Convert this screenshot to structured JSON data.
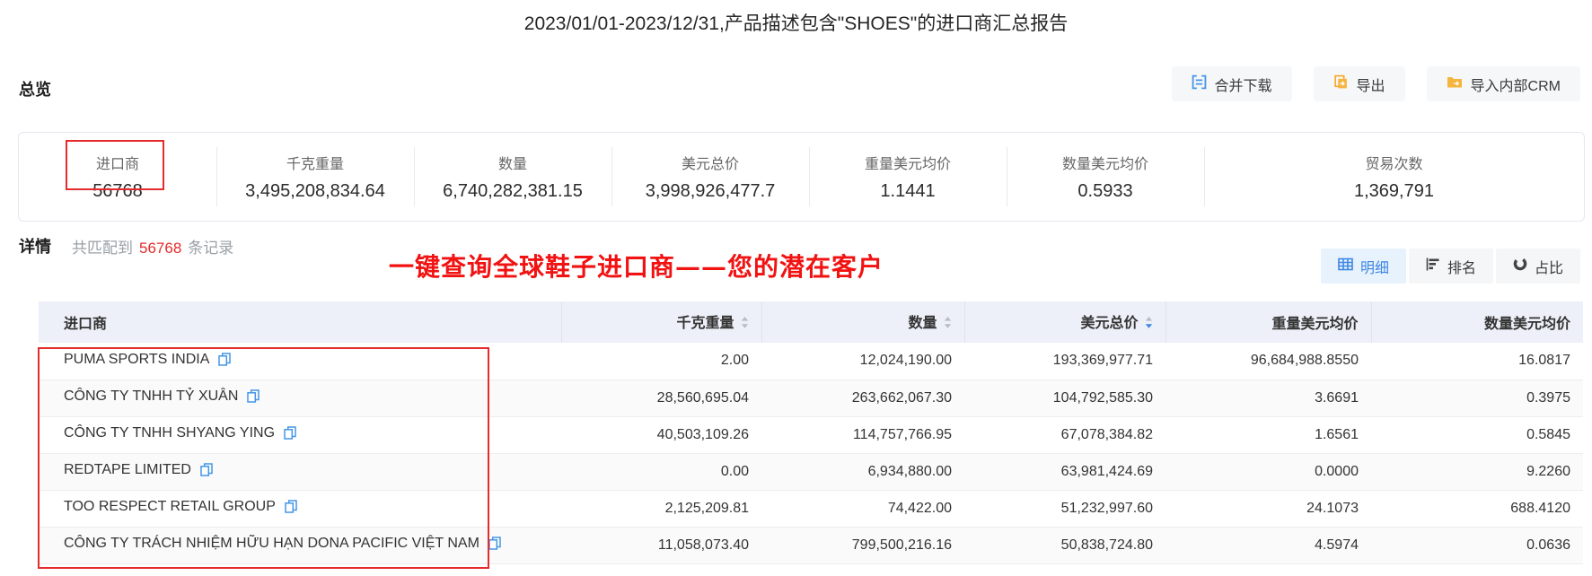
{
  "page": {
    "title": "2023/01/01-2023/12/31,产品描述包含\"SHOES\"的进口商汇总报告"
  },
  "overview": {
    "heading": "总览",
    "actions": {
      "merge_download": "合并下载",
      "export": "导出",
      "import_crm": "导入内部CRM"
    },
    "stats": [
      {
        "label": "进口商",
        "value": "56768"
      },
      {
        "label": "千克重量",
        "value": "3,495,208,834.64"
      },
      {
        "label": "数量",
        "value": "6,740,282,381.15"
      },
      {
        "label": "美元总价",
        "value": "3,998,926,477.7"
      },
      {
        "label": "重量美元均价",
        "value": "1.1441"
      },
      {
        "label": "数量美元均价",
        "value": "0.5933"
      },
      {
        "label": "贸易次数",
        "value": "1,369,791"
      }
    ]
  },
  "detail": {
    "heading": "详情",
    "match_prefix": "共匹配到",
    "match_count": "56768",
    "match_suffix": "条记录",
    "annotation": "一键查询全球鞋子进口商——您的潜在客户",
    "tabs": [
      {
        "label": "明细"
      },
      {
        "label": "排名"
      },
      {
        "label": "占比"
      }
    ]
  },
  "table": {
    "columns": [
      {
        "label": "进口商"
      },
      {
        "label": "千克重量"
      },
      {
        "label": "数量"
      },
      {
        "label": "美元总价"
      },
      {
        "label": "重量美元均价"
      },
      {
        "label": "数量美元均价"
      }
    ],
    "rows": [
      {
        "name": "PUMA SPORTS INDIA",
        "values": [
          "2.00",
          "12,024,190.00",
          "193,369,977.71",
          "96,684,988.8550",
          "16.0817"
        ]
      },
      {
        "name": "CÔNG TY TNHH TỶ XUÂN",
        "values": [
          "28,560,695.04",
          "263,662,067.30",
          "104,792,585.30",
          "3.6691",
          "0.3975"
        ]
      },
      {
        "name": "CÔNG TY TNHH SHYANG YING",
        "values": [
          "40,503,109.26",
          "114,757,766.95",
          "67,078,384.82",
          "1.6561",
          "0.5845"
        ]
      },
      {
        "name": "REDTAPE LIMITED",
        "values": [
          "0.00",
          "6,934,880.00",
          "63,981,424.69",
          "0.0000",
          "9.2260"
        ]
      },
      {
        "name": "TOO RESPECT RETAIL GROUP",
        "values": [
          "2,125,209.81",
          "74,422.00",
          "51,232,997.60",
          "24.1073",
          "688.4120"
        ]
      },
      {
        "name": "CÔNG TY TRÁCH NHIỆM HỮU HẠN DONA PACIFIC VIỆT NAM",
        "values": [
          "11,058,073.40",
          "799,500,216.16",
          "50,838,724.80",
          "4.5974",
          "0.0636"
        ]
      }
    ]
  },
  "colors": {
    "accent_blue": "#3d87e4",
    "highlight_red": "#e52b2b",
    "icon_orange": "#f5a623",
    "table_header_bg": "#edf0f8"
  }
}
